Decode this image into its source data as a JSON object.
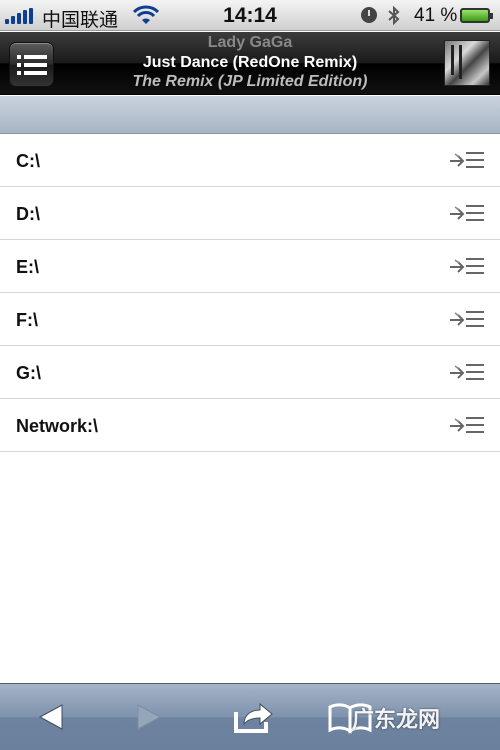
{
  "status_bar": {
    "carrier": "中国联通",
    "time": "14:14",
    "battery": "41 %"
  },
  "now_playing": {
    "artist": "Lady GaGa",
    "title": "Just Dance (RedOne Remix)",
    "album": "The Remix (JP Limited Edition)"
  },
  "drives": [
    {
      "label": "C:\\"
    },
    {
      "label": "D:\\"
    },
    {
      "label": "E:\\"
    },
    {
      "label": "F:\\"
    },
    {
      "label": "G:\\"
    },
    {
      "label": "Network:\\"
    }
  ],
  "icons": {
    "menu": "menu-list-icon",
    "queue": "add-to-queue-icon",
    "back": "back-arrow-icon",
    "forward": "forward-arrow-icon",
    "share": "share-icon",
    "bookmarks": "bookmarks-icon"
  },
  "watermark": "广东龙网",
  "colors": {
    "header_bg": "#1a1a1a",
    "section_header": "#b7c2d0",
    "toolbar": "#7f93ad"
  }
}
